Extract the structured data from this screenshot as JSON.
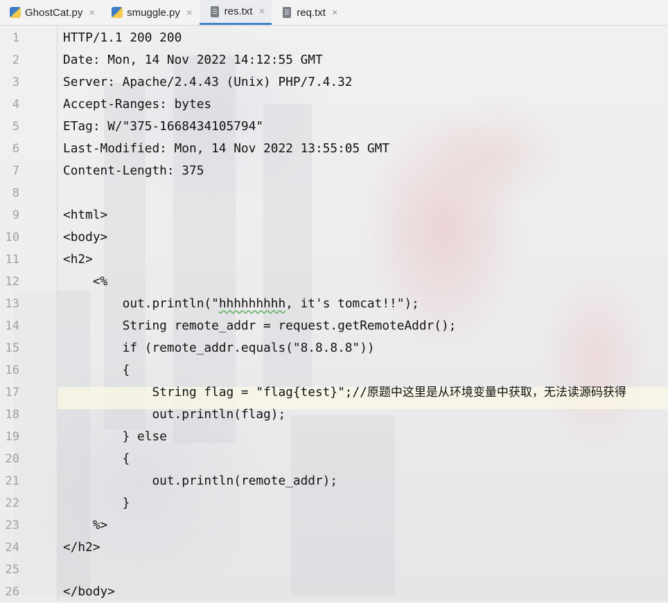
{
  "tabs": [
    {
      "label": "GhostCat.py",
      "icon": "python-file-icon",
      "active": false
    },
    {
      "label": "smuggle.py",
      "icon": "python-file-icon",
      "active": false
    },
    {
      "label": "res.txt",
      "icon": "text-file-icon",
      "active": true
    },
    {
      "label": "req.txt",
      "icon": "text-file-icon",
      "active": false
    }
  ],
  "close_glyph": "×",
  "accent_color": "#4083c9",
  "line_numbers": [
    "1",
    "2",
    "3",
    "4",
    "5",
    "6",
    "7",
    "8",
    "9",
    "10",
    "11",
    "12",
    "13",
    "14",
    "15",
    "16",
    "17",
    "18",
    "19",
    "20",
    "21",
    "22",
    "23",
    "24",
    "25",
    "26"
  ],
  "lines": [
    "HTTP/1.1 200 200",
    "Date: Mon, 14 Nov 2022 14:12:55 GMT",
    "Server: Apache/2.4.43 (Unix) PHP/7.4.32",
    "Accept-Ranges: bytes",
    "ETag: W/\"375-1668434105794\"",
    "Last-Modified: Mon, 14 Nov 2022 13:55:05 GMT",
    "Content-Length: 375",
    "",
    "<html>",
    "<body>",
    "<h2>",
    "    <%",
    "        out.println(\"hhhhhhhhh, it's tomcat!!\");",
    "        String remote_addr = request.getRemoteAddr();",
    "        if (remote_addr.equals(\"8.8.8.8\"))",
    "        {",
    "            String flag = \"flag{test}\";//原题中这里是从环境变量中获取，无法读源码获得",
    "            out.println(flag);",
    "        } else",
    "        {",
    "            out.println(remote_addr);",
    "        }",
    "    %>",
    "</h2>",
    "",
    "</body>"
  ],
  "line13_parts": {
    "a": "        out.println(\"",
    "b": "hhhhhhhhh",
    "c": ", it's tomcat!!\");"
  },
  "line17_parts": {
    "code": "            String flag = \"flag{test}\";//",
    "comment": "原题中这里是从环境变量中获取，无法读源码获得"
  },
  "highlighted_line": "17"
}
